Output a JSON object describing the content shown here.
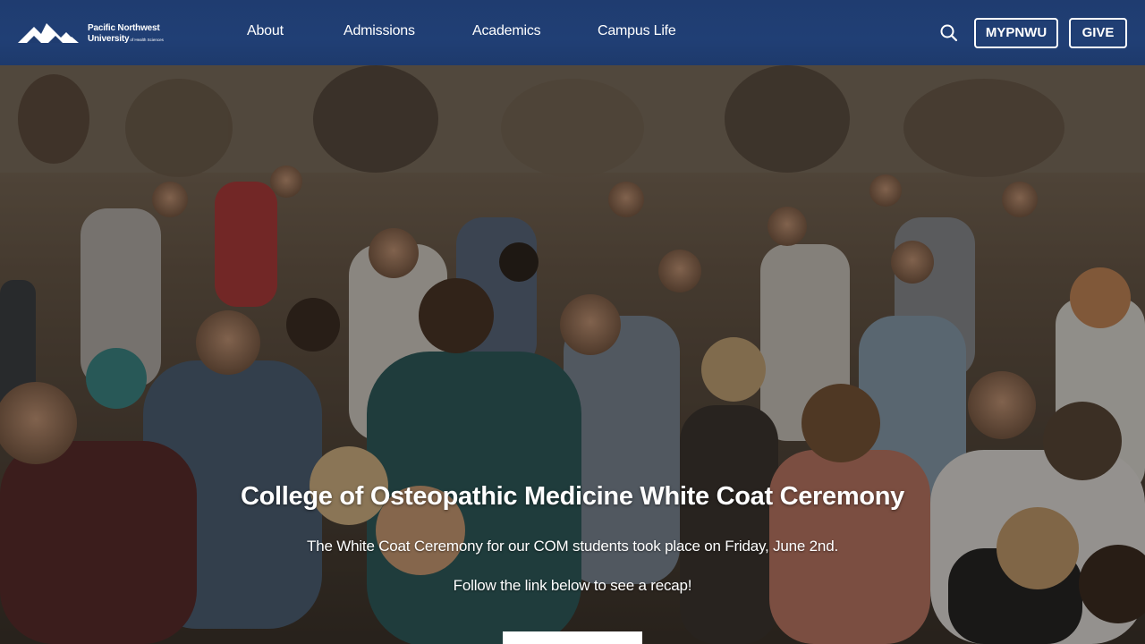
{
  "header": {
    "logo": {
      "line1": "Pacific Northwest",
      "line2": "University",
      "line3": "of Health Sciences"
    },
    "nav": [
      {
        "label": "About"
      },
      {
        "label": "Admissions"
      },
      {
        "label": "Academics"
      },
      {
        "label": "Campus Life"
      }
    ],
    "search_icon": "search-icon",
    "buttons": {
      "mypnwu": "MYPNWU",
      "give": "GIVE"
    },
    "colors": {
      "header_bg": "#1f3c70",
      "text": "#ffffff"
    }
  },
  "hero": {
    "title": "College of Osteopathic Medicine White Coat Ceremony",
    "subtitle": "The White Coat Ceremony for our COM students took place on Friday, June 2nd.",
    "cta_text": "Follow the link below to see a recap!",
    "button_label": ""
  }
}
